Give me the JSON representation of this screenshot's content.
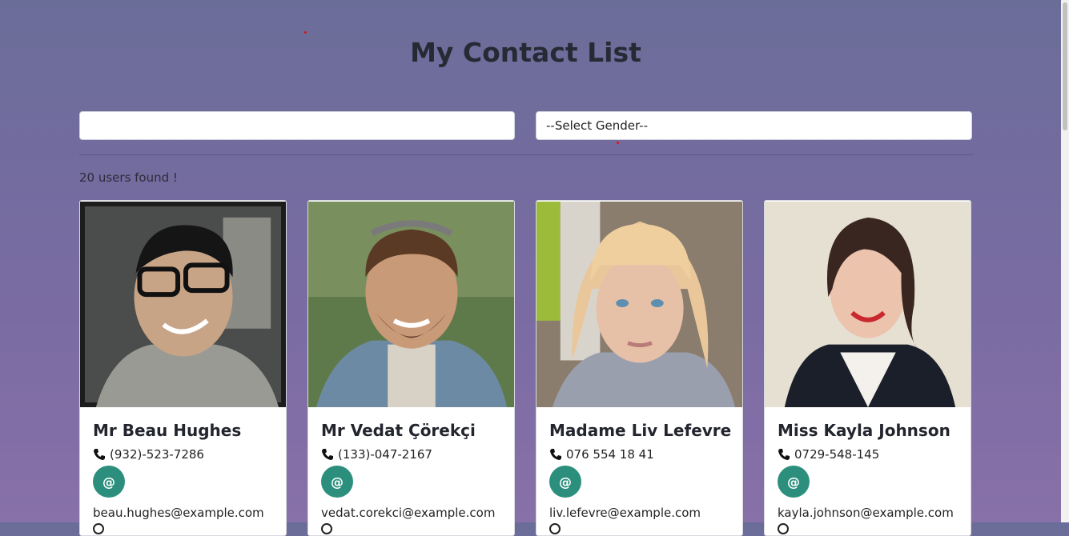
{
  "page": {
    "title": "My Contact List"
  },
  "filters": {
    "search_value": "",
    "search_placeholder": "",
    "gender_selected": "--Select Gender--"
  },
  "results": {
    "count_text": "20 users found !"
  },
  "colors": {
    "background": "#7a6ca3",
    "email_button": "#2c8f7d"
  },
  "contacts": [
    {
      "name": "Mr Beau Hughes",
      "phone": "(932)-523-7286",
      "email_icon_label": "@",
      "email": "beau.hughes@example.com"
    },
    {
      "name": "Mr Vedat Çörekçi",
      "phone": "(133)-047-2167",
      "email_icon_label": "@",
      "email": "vedat.corekci@example.com"
    },
    {
      "name": "Madame Liv Lefevre",
      "phone": "076 554 18 41",
      "email_icon_label": "@",
      "email": "liv.lefevre@example.com"
    },
    {
      "name": "Miss Kayla Johnson",
      "phone": "0729-548-145",
      "email_icon_label": "@",
      "email": "kayla.johnson@example.com"
    }
  ]
}
